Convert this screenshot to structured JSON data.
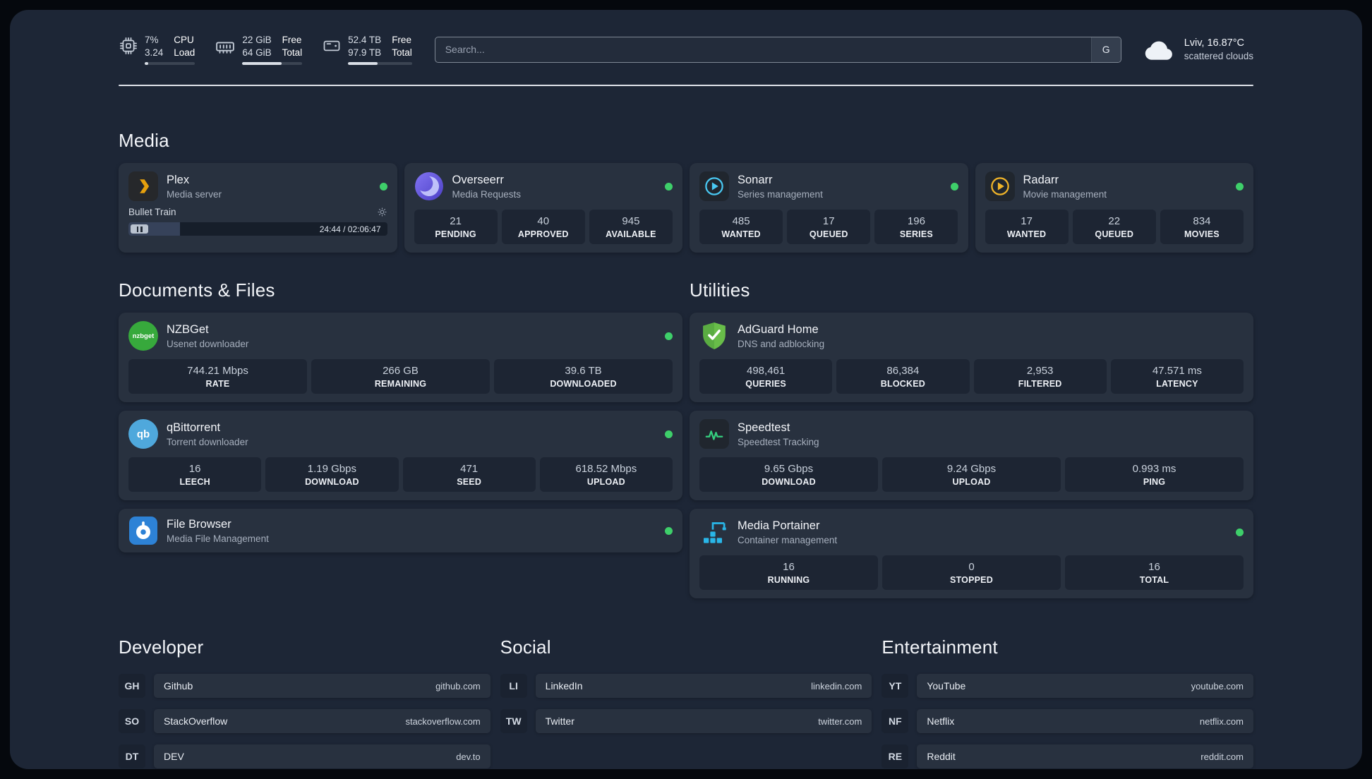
{
  "topbar": {
    "cpu": {
      "value_top": "7%",
      "value_bottom": "3.24",
      "label_top": "CPU",
      "label_bottom": "Load",
      "bar_percent": 7
    },
    "ram": {
      "value_top": "22 GiB",
      "value_bottom": "64 GiB",
      "label_top": "Free",
      "label_bottom": "Total",
      "bar_percent": 66
    },
    "disk": {
      "value_top": "52.4 TB",
      "value_bottom": "97.9 TB",
      "label_top": "Free",
      "label_bottom": "Total",
      "bar_percent": 46
    },
    "search": {
      "placeholder": "Search...",
      "engine_button": "G"
    },
    "weather": {
      "location": "Lviv, 16.87°C",
      "condition": "scattered clouds"
    }
  },
  "media": {
    "heading": "Media",
    "plex": {
      "name": "Plex",
      "desc": "Media server",
      "now_playing": "Bullet Train",
      "time": "24:44 / 02:06:47",
      "progress_percent": 20
    },
    "overseerr": {
      "name": "Overseerr",
      "desc": "Media Requests",
      "stats": [
        {
          "value": "21",
          "label": "PENDING"
        },
        {
          "value": "40",
          "label": "APPROVED"
        },
        {
          "value": "945",
          "label": "AVAILABLE"
        }
      ]
    },
    "sonarr": {
      "name": "Sonarr",
      "desc": "Series management",
      "stats": [
        {
          "value": "485",
          "label": "WANTED"
        },
        {
          "value": "17",
          "label": "QUEUED"
        },
        {
          "value": "196",
          "label": "SERIES"
        }
      ]
    },
    "radarr": {
      "name": "Radarr",
      "desc": "Movie management",
      "stats": [
        {
          "value": "17",
          "label": "WANTED"
        },
        {
          "value": "22",
          "label": "QUEUED"
        },
        {
          "value": "834",
          "label": "MOVIES"
        }
      ]
    }
  },
  "documents": {
    "heading": "Documents & Files",
    "nzbget": {
      "name": "NZBGet",
      "desc": "Usenet downloader",
      "icon_text": "nzbget",
      "stats": [
        {
          "value": "744.21 Mbps",
          "label": "RATE"
        },
        {
          "value": "266 GB",
          "label": "REMAINING"
        },
        {
          "value": "39.6 TB",
          "label": "DOWNLOADED"
        }
      ]
    },
    "qbittorrent": {
      "name": "qBittorrent",
      "desc": "Torrent downloader",
      "icon_text": "qb",
      "stats": [
        {
          "value": "16",
          "label": "LEECH"
        },
        {
          "value": "1.19 Gbps",
          "label": "DOWNLOAD"
        },
        {
          "value": "471",
          "label": "SEED"
        },
        {
          "value": "618.52 Mbps",
          "label": "UPLOAD"
        }
      ]
    },
    "filebrowser": {
      "name": "File Browser",
      "desc": "Media File Management"
    }
  },
  "utilities": {
    "heading": "Utilities",
    "adguard": {
      "name": "AdGuard Home",
      "desc": "DNS and adblocking",
      "stats": [
        {
          "value": "498,461",
          "label": "QUERIES"
        },
        {
          "value": "86,384",
          "label": "BLOCKED"
        },
        {
          "value": "2,953",
          "label": "FILTERED"
        },
        {
          "value": "47.571 ms",
          "label": "LATENCY"
        }
      ]
    },
    "speedtest": {
      "name": "Speedtest",
      "desc": "Speedtest Tracking",
      "stats": [
        {
          "value": "9.65 Gbps",
          "label": "DOWNLOAD"
        },
        {
          "value": "9.24 Gbps",
          "label": "UPLOAD"
        },
        {
          "value": "0.993 ms",
          "label": "PING"
        }
      ]
    },
    "portainer": {
      "name": "Media Portainer",
      "desc": "Container management",
      "stats": [
        {
          "value": "16",
          "label": "RUNNING"
        },
        {
          "value": "0",
          "label": "STOPPED"
        },
        {
          "value": "16",
          "label": "TOTAL"
        }
      ]
    }
  },
  "bookmarks": {
    "developer": {
      "heading": "Developer",
      "items": [
        {
          "abbr": "GH",
          "name": "Github",
          "url": "github.com"
        },
        {
          "abbr": "SO",
          "name": "StackOverflow",
          "url": "stackoverflow.com"
        },
        {
          "abbr": "DT",
          "name": "DEV",
          "url": "dev.to"
        }
      ]
    },
    "social": {
      "heading": "Social",
      "items": [
        {
          "abbr": "LI",
          "name": "LinkedIn",
          "url": "linkedin.com"
        },
        {
          "abbr": "TW",
          "name": "Twitter",
          "url": "twitter.com"
        }
      ]
    },
    "entertainment": {
      "heading": "Entertainment",
      "items": [
        {
          "abbr": "YT",
          "name": "YouTube",
          "url": "youtube.com"
        },
        {
          "abbr": "NF",
          "name": "Netflix",
          "url": "netflix.com"
        },
        {
          "abbr": "RE",
          "name": "Reddit",
          "url": "reddit.com"
        }
      ]
    }
  },
  "colors": {
    "status_online": "#3ecf6a",
    "plex_accent": "#e5a00d"
  }
}
